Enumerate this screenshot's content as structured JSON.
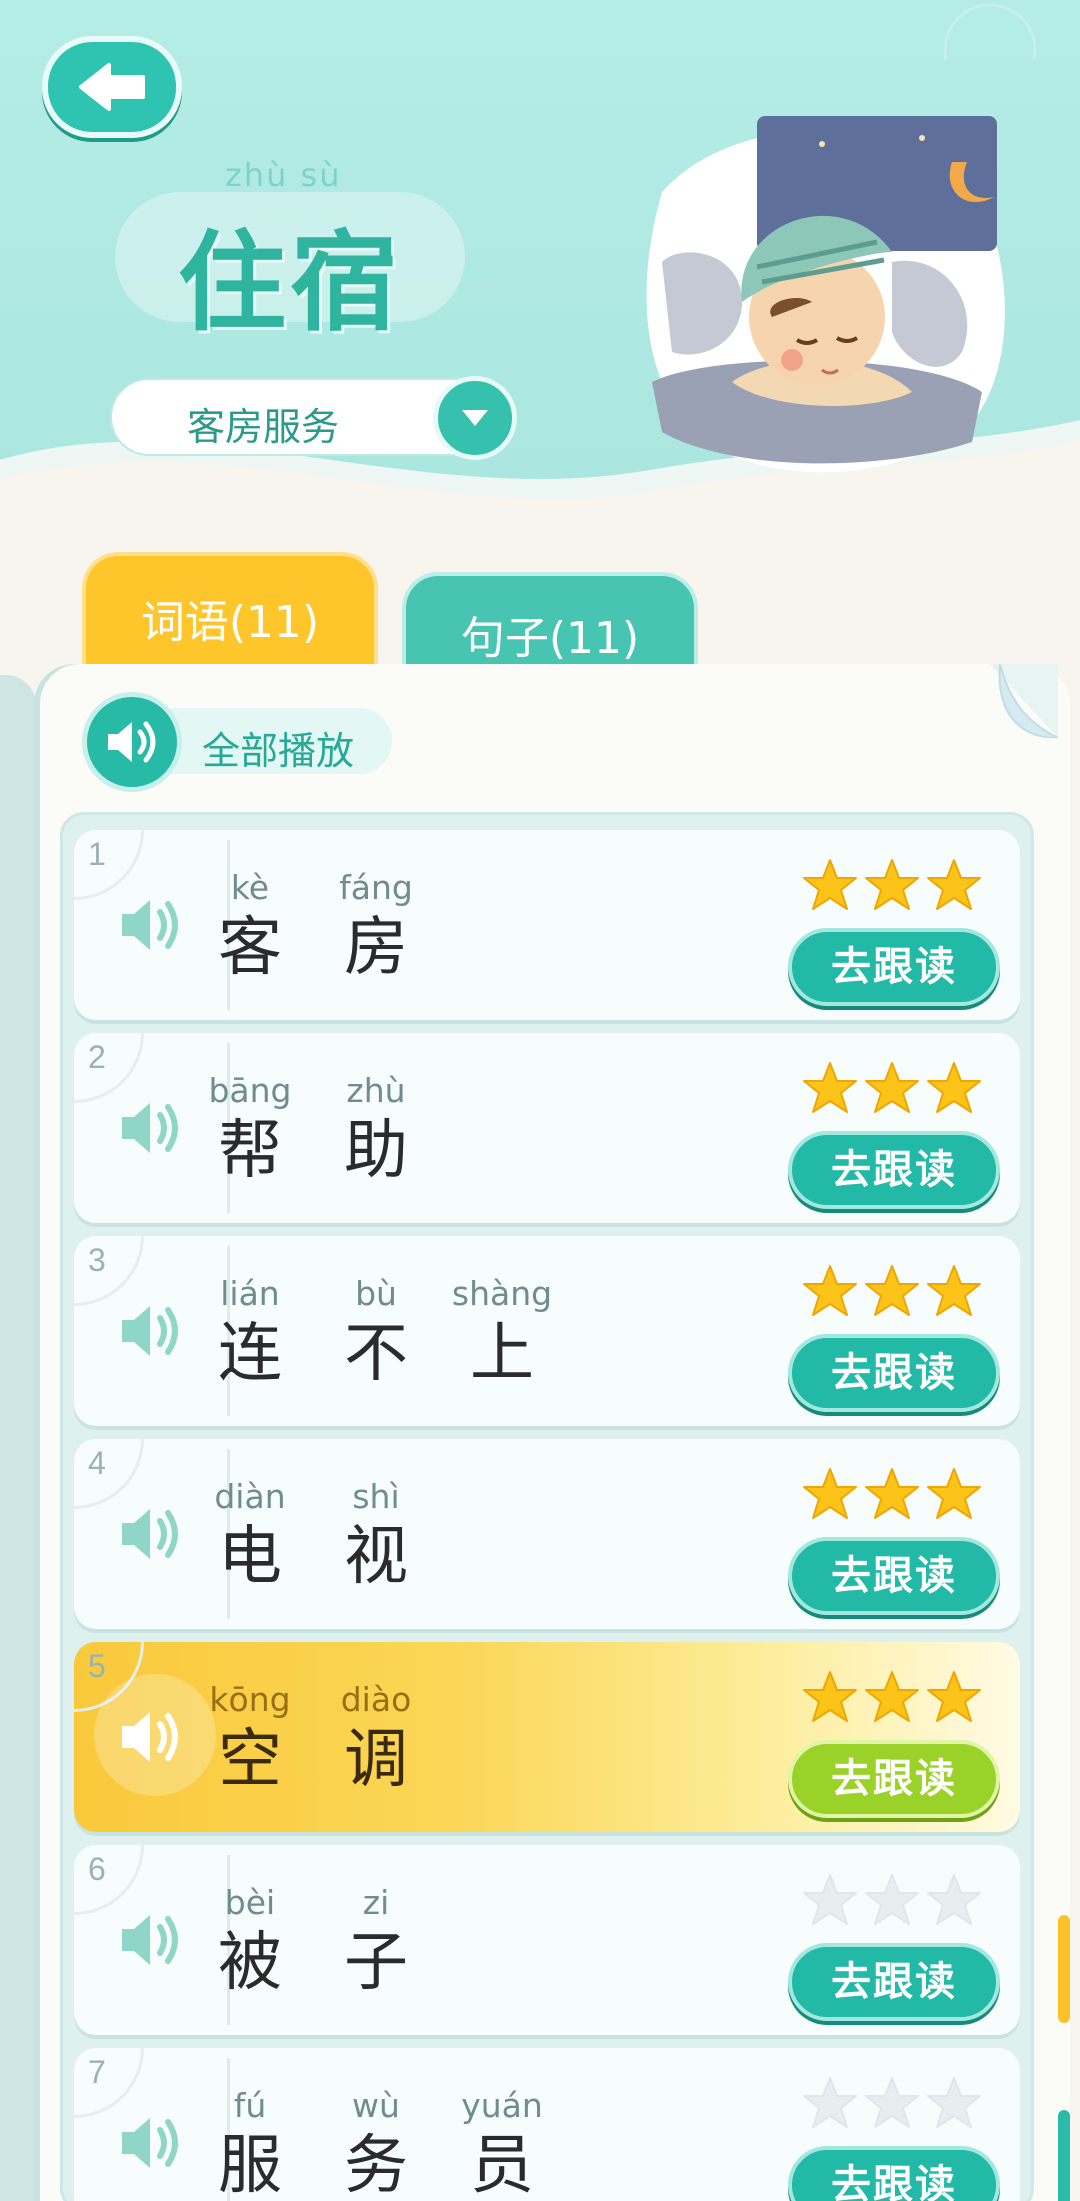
{
  "header": {
    "title_pinyin": "zhù sù",
    "title": "住宿",
    "category_selected": "客房服务"
  },
  "tabs": [
    {
      "label": "词语(11)",
      "active": true
    },
    {
      "label": "句子(11)",
      "active": false
    }
  ],
  "play_all_label": "全部播放",
  "colors": {
    "accent": "#22b9a7",
    "highlight": "#fcc22a",
    "active_button": "#9bd229"
  },
  "words": [
    {
      "num": "1",
      "syllables": [
        {
          "py": "kè",
          "hz": "客"
        },
        {
          "py": "fáng",
          "hz": "房"
        }
      ],
      "stars": 3,
      "button": "去跟读",
      "active": false
    },
    {
      "num": "2",
      "syllables": [
        {
          "py": "bāng",
          "hz": "帮"
        },
        {
          "py": "zhù",
          "hz": "助"
        }
      ],
      "stars": 3,
      "button": "去跟读",
      "active": false
    },
    {
      "num": "3",
      "syllables": [
        {
          "py": "lián",
          "hz": "连"
        },
        {
          "py": "bù",
          "hz": "不"
        },
        {
          "py": "shàng",
          "hz": "上"
        }
      ],
      "stars": 3,
      "button": "去跟读",
      "active": false
    },
    {
      "num": "4",
      "syllables": [
        {
          "py": "diàn",
          "hz": "电"
        },
        {
          "py": "shì",
          "hz": "视"
        }
      ],
      "stars": 3,
      "button": "去跟读",
      "active": false
    },
    {
      "num": "5",
      "syllables": [
        {
          "py": "kōng",
          "hz": "空"
        },
        {
          "py": "diào",
          "hz": "调"
        }
      ],
      "stars": 3,
      "button": "去跟读",
      "active": true
    },
    {
      "num": "6",
      "syllables": [
        {
          "py": "bèi",
          "hz": "被"
        },
        {
          "py": "zi",
          "hz": "子"
        }
      ],
      "stars": 0,
      "button": "去跟读",
      "active": false
    },
    {
      "num": "7",
      "syllables": [
        {
          "py": "fú",
          "hz": "服"
        },
        {
          "py": "wù",
          "hz": "务"
        },
        {
          "py": "yuán",
          "hz": "员"
        }
      ],
      "stars": 0,
      "button": "去跟读",
      "active": false
    }
  ]
}
